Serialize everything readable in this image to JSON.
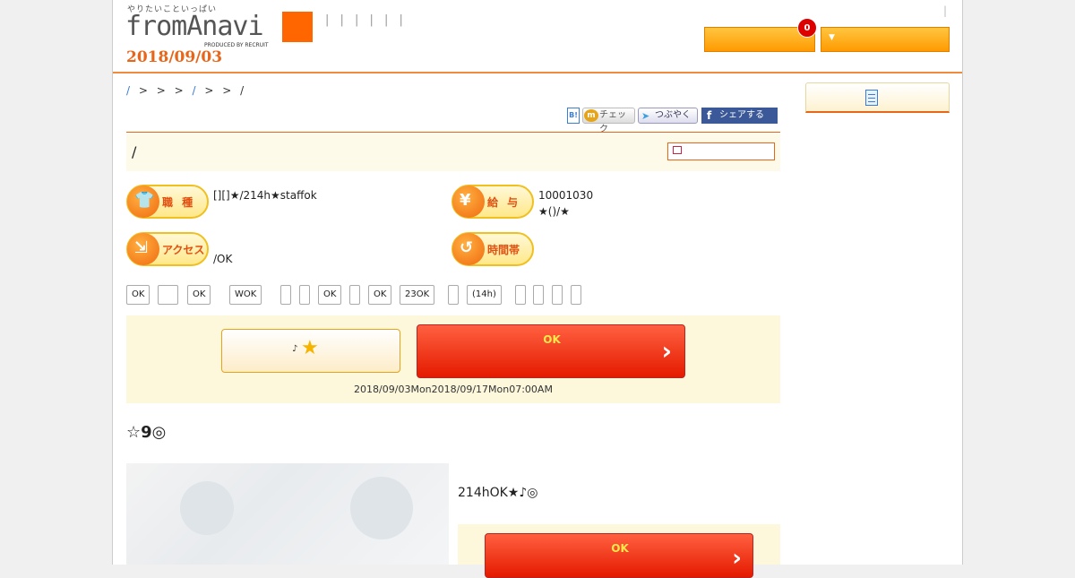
{
  "header": {
    "tagline": "やりたいこといっぱい",
    "logo_text": "fromAnavi",
    "produced_by": "PRODUCED BY RECRUIT",
    "nav_separators": "| | | | | |",
    "date": "2018/09/03",
    "top_separator": "|",
    "badge_count": "0",
    "dropdown_marker": "▼"
  },
  "breadcrumb": {
    "text_a": "/",
    "text_b": "> > >",
    "text_c": "/",
    "text_d": "> > /"
  },
  "share": {
    "hatena": "B!",
    "mixi_icon": "m",
    "mixi": "チェック",
    "twitter": "つぶやく",
    "facebook_icon": "f",
    "facebook": "シェアする"
  },
  "job": {
    "title": "/",
    "occupation_label": "職 種",
    "occupation": "[][]★/214h★staffok",
    "salary_label": "給 与",
    "salary_line1": "10001030",
    "salary_line2": "★()/★",
    "access_label": "アクセス",
    "access": "/OK",
    "hours_label": "時間帯",
    "hours": ""
  },
  "tags": [
    "OK",
    "",
    "OK",
    "WOK",
    "",
    "",
    "OK",
    "",
    "OK",
    "23OK",
    "",
    "(14h)",
    "",
    "",
    "",
    ""
  ],
  "apply": {
    "keep_note": "♪",
    "keep_star": "★",
    "ok_label": "OK",
    "arrow": "›",
    "period": "2018/09/03Mon2018/09/17Mon07:00AM"
  },
  "catch": {
    "star": "☆",
    "text": "9",
    "mark": "◎"
  },
  "description": "214hOK★♪◎",
  "apply2": {
    "ok_label": "OK",
    "arrow": "›"
  },
  "colors": {
    "brand_orange": "#e8661a",
    "apply_red": "#e41a00",
    "highlight_yellow": "#fdf8dc"
  }
}
